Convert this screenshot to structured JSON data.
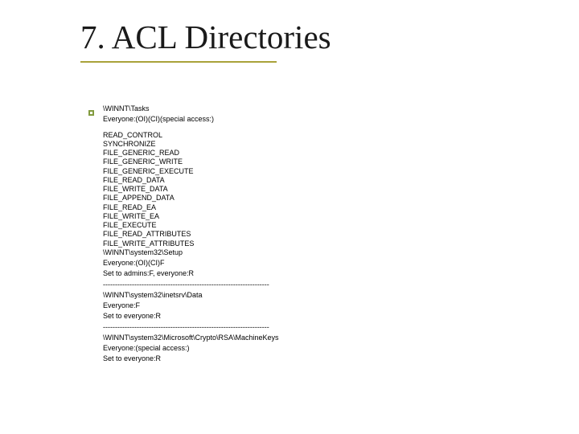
{
  "title": "7. ACL Directories",
  "section1": {
    "path": "\\WINNT\\Tasks",
    "ace": "Everyone:(OI)(CI)(special access:)",
    "perms": [
      "READ_CONTROL",
      "SYNCHRONIZE",
      "FILE_GENERIC_READ",
      "FILE_GENERIC_WRITE",
      "FILE_GENERIC_EXECUTE",
      "FILE_READ_DATA",
      "FILE_WRITE_DATA",
      "FILE_APPEND_DATA",
      "FILE_READ_EA",
      "FILE_WRITE_EA",
      "FILE_EXECUTE",
      "FILE_READ_ATTRIBUTES",
      "FILE_WRITE_ATTRIBUTES"
    ]
  },
  "section2": {
    "path": "\\WINNT\\system32\\Setup",
    "ace": "Everyone:(OI)(CI)F",
    "action": "Set to admins:F, everyone:R",
    "divider": "---------------------------------------------------------------------"
  },
  "section3": {
    "path": "\\WINNT\\system32\\inetsrv\\Data",
    "ace": "Everyone:F",
    "action": "Set to everyone:R",
    "divider": "---------------------------------------------------------------------"
  },
  "section4": {
    "path": "\\WINNT\\system32\\Microsoft\\Crypto\\RSA\\MachineKeys",
    "ace": "Everyone:(special access:)",
    "action": "Set to everyone:R"
  }
}
